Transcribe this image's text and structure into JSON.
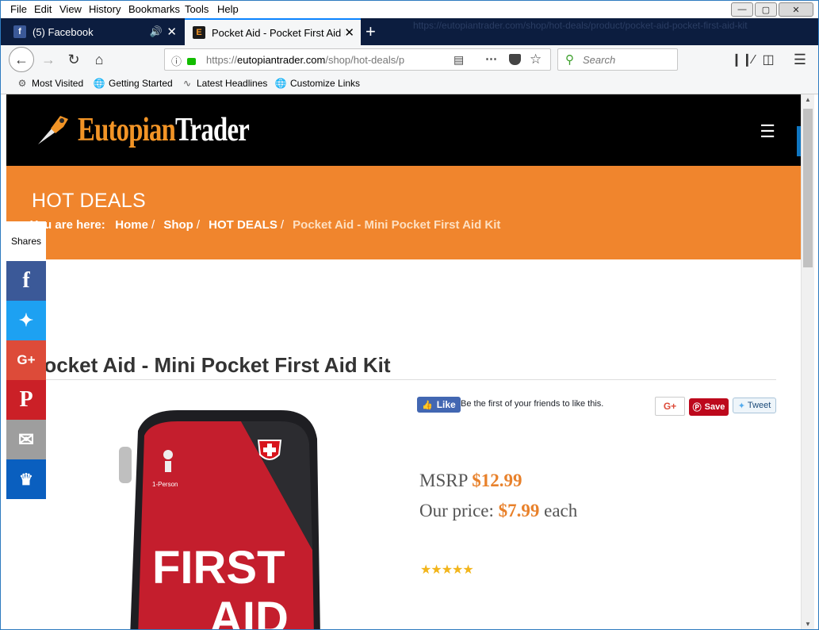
{
  "menu": {
    "file": "File",
    "edit": "Edit",
    "view": "View",
    "history": "History",
    "bookmarks": "Bookmarks",
    "tools": "Tools",
    "help": "Help"
  },
  "tabs": [
    {
      "label": "(5) Facebook",
      "favicon": "f"
    },
    {
      "label": "Pocket Aid - Pocket First Aid Kit",
      "favicon": "E"
    }
  ],
  "tabstrip_bg_text": "https://eutopiantrader.com/shop/hot-deals/product/pocket-aid-pocket-first-aid-kit",
  "url": {
    "prefix": "https://",
    "host": "eutopiantrader.com",
    "path": "/shop/hot-deals/p"
  },
  "search": {
    "placeholder": "Search"
  },
  "bookmarks": [
    {
      "label": "Most Visited",
      "icon": "gear-icon"
    },
    {
      "label": "Getting Started",
      "icon": "globe-icon"
    },
    {
      "label": "Latest Headlines",
      "icon": "rss-icon"
    },
    {
      "label": "Customize Links",
      "icon": "globe-icon"
    }
  ],
  "site": {
    "logo_a": "Eutopian",
    "logo_b": "Trader",
    "hero_title": "HOT DEALS",
    "breadcrumb": {
      "prefix": "You are here:",
      "items": [
        "Home",
        "Shop",
        "HOT DEALS",
        "Pocket Aid - Mini Pocket First Aid Kit"
      ]
    },
    "product_title": "Pocket Aid - Mini Pocket First Aid Kit"
  },
  "share": {
    "label": "Shares"
  },
  "social": {
    "fb_like": "Like",
    "fb_text": "Be the first of your friends to like this.",
    "gplus": "G+",
    "pin": "Save",
    "tweet": "Tweet"
  },
  "pricing": {
    "msrp_label": "MSRP",
    "msrp": "$12.99",
    "our_label": "Our price:",
    "our_price": "$7.99",
    "unit": "each"
  },
  "rating": {
    "stars": 5
  },
  "product_image": {
    "person_label": "1-Person",
    "line1": "FIRST",
    "line2": "AID"
  },
  "colors": {
    "accent": "#f0852d",
    "header": "#000000",
    "price": "#e8812b"
  }
}
